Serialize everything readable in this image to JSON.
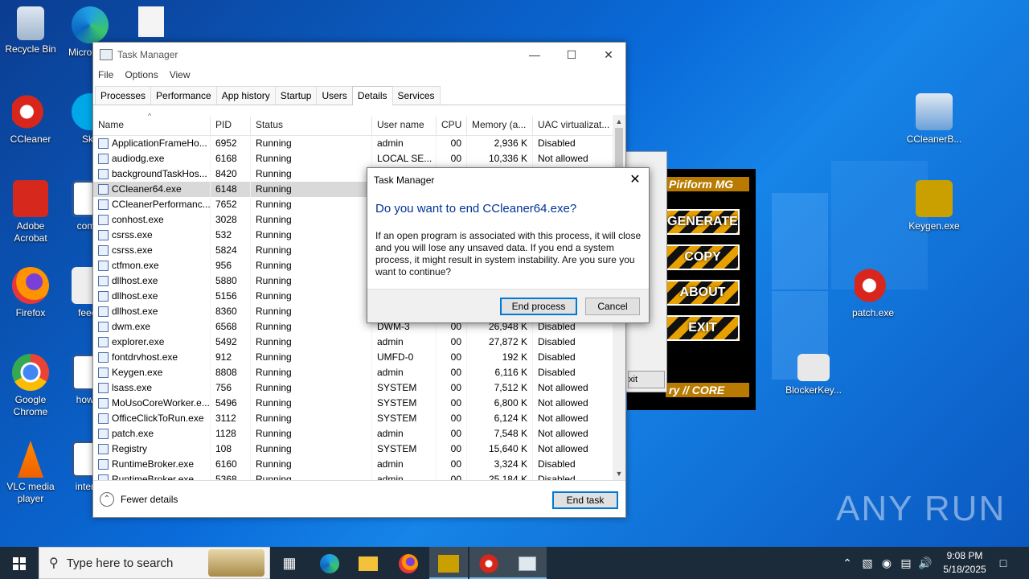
{
  "desktop": {
    "icons_left": [
      {
        "label": "Recycle Bin"
      },
      {
        "label": "CCleaner"
      },
      {
        "label": "Adobe Acrobat"
      },
      {
        "label": "Firefox"
      },
      {
        "label": "Google Chrome"
      },
      {
        "label": "VLC media player"
      }
    ],
    "icons_col2": [
      {
        "label": "Micro Edg"
      },
      {
        "label": "Sky"
      },
      {
        "label": "comm"
      },
      {
        "label": "feeou"
      },
      {
        "label": "howev"
      },
      {
        "label": "interne"
      }
    ],
    "icons_right": [
      {
        "label": "CCleanerB..."
      },
      {
        "label": "Keygen.exe"
      },
      {
        "label": "patch.exe"
      },
      {
        "label": "BlockerKey..."
      }
    ],
    "watermark": "ANY RUN"
  },
  "keygen": {
    "banner_top": "Piriform MG",
    "buttons": [
      "GENERATE",
      "COPY",
      "ABOUT",
      "EXIT"
    ],
    "banner_bottom": "ry // CORE",
    "partial_button": "xit"
  },
  "taskmanager": {
    "title": "Task Manager",
    "menu": [
      "File",
      "Options",
      "View"
    ],
    "tabs": [
      "Processes",
      "Performance",
      "App history",
      "Startup",
      "Users",
      "Details",
      "Services"
    ],
    "active_tab": "Details",
    "columns": [
      "Name",
      "PID",
      "Status",
      "User name",
      "CPU",
      "Memory (a...",
      "UAC virtualizat..."
    ],
    "rows": [
      {
        "name": "ApplicationFrameHo...",
        "pid": "6952",
        "status": "Running",
        "user": "admin",
        "cpu": "00",
        "mem": "2,936 K",
        "uac": "Disabled"
      },
      {
        "name": "audiodg.exe",
        "pid": "6168",
        "status": "Running",
        "user": "LOCAL SE...",
        "cpu": "00",
        "mem": "10,336 K",
        "uac": "Not allowed"
      },
      {
        "name": "backgroundTaskHos...",
        "pid": "8420",
        "status": "Running",
        "user": "",
        "cpu": "",
        "mem": "",
        "uac": ""
      },
      {
        "name": "CCleaner64.exe",
        "pid": "6148",
        "status": "Running",
        "user": "",
        "cpu": "",
        "mem": "",
        "uac": "",
        "selected": true
      },
      {
        "name": "CCleanerPerformanc...",
        "pid": "7652",
        "status": "Running",
        "user": "",
        "cpu": "",
        "mem": "",
        "uac": ""
      },
      {
        "name": "conhost.exe",
        "pid": "3028",
        "status": "Running",
        "user": "",
        "cpu": "",
        "mem": "",
        "uac": ""
      },
      {
        "name": "csrss.exe",
        "pid": "532",
        "status": "Running",
        "user": "",
        "cpu": "",
        "mem": "",
        "uac": ""
      },
      {
        "name": "csrss.exe",
        "pid": "5824",
        "status": "Running",
        "user": "",
        "cpu": "",
        "mem": "",
        "uac": ""
      },
      {
        "name": "ctfmon.exe",
        "pid": "956",
        "status": "Running",
        "user": "",
        "cpu": "",
        "mem": "",
        "uac": ""
      },
      {
        "name": "dllhost.exe",
        "pid": "5880",
        "status": "Running",
        "user": "",
        "cpu": "",
        "mem": "",
        "uac": ""
      },
      {
        "name": "dllhost.exe",
        "pid": "5156",
        "status": "Running",
        "user": "",
        "cpu": "",
        "mem": "",
        "uac": ""
      },
      {
        "name": "dllhost.exe",
        "pid": "8360",
        "status": "Running",
        "user": "",
        "cpu": "",
        "mem": "",
        "uac": ""
      },
      {
        "name": "dwm.exe",
        "pid": "6568",
        "status": "Running",
        "user": "DWM-3",
        "cpu": "00",
        "mem": "26,948 K",
        "uac": "Disabled"
      },
      {
        "name": "explorer.exe",
        "pid": "5492",
        "status": "Running",
        "user": "admin",
        "cpu": "00",
        "mem": "27,872 K",
        "uac": "Disabled"
      },
      {
        "name": "fontdrvhost.exe",
        "pid": "912",
        "status": "Running",
        "user": "UMFD-0",
        "cpu": "00",
        "mem": "192 K",
        "uac": "Disabled"
      },
      {
        "name": "Keygen.exe",
        "pid": "8808",
        "status": "Running",
        "user": "admin",
        "cpu": "00",
        "mem": "6,116 K",
        "uac": "Disabled"
      },
      {
        "name": "lsass.exe",
        "pid": "756",
        "status": "Running",
        "user": "SYSTEM",
        "cpu": "00",
        "mem": "7,512 K",
        "uac": "Not allowed"
      },
      {
        "name": "MoUsoCoreWorker.e...",
        "pid": "5496",
        "status": "Running",
        "user": "SYSTEM",
        "cpu": "00",
        "mem": "6,800 K",
        "uac": "Not allowed"
      },
      {
        "name": "OfficeClickToRun.exe",
        "pid": "3112",
        "status": "Running",
        "user": "SYSTEM",
        "cpu": "00",
        "mem": "6,124 K",
        "uac": "Not allowed"
      },
      {
        "name": "patch.exe",
        "pid": "1128",
        "status": "Running",
        "user": "admin",
        "cpu": "00",
        "mem": "7,548 K",
        "uac": "Not allowed"
      },
      {
        "name": "Registry",
        "pid": "108",
        "status": "Running",
        "user": "SYSTEM",
        "cpu": "00",
        "mem": "15,640 K",
        "uac": "Not allowed"
      },
      {
        "name": "RuntimeBroker.exe",
        "pid": "6160",
        "status": "Running",
        "user": "admin",
        "cpu": "00",
        "mem": "3,324 K",
        "uac": "Disabled"
      },
      {
        "name": "RuntimeBroker.exe",
        "pid": "5368",
        "status": "Running",
        "user": "admin",
        "cpu": "00",
        "mem": "25,184 K",
        "uac": "Disabled"
      }
    ],
    "fewer_details": "Fewer details",
    "end_task": "End task"
  },
  "dialog": {
    "title": "Task Manager",
    "question": "Do you want to end CCleaner64.exe?",
    "message": "If an open program is associated with this process, it will close and you will lose any unsaved data. If you end a system process, it might result in system instability. Are you sure you want to continue?",
    "end_process": "End process",
    "cancel": "Cancel"
  },
  "taskbar": {
    "search_placeholder": "Type here to search",
    "time": "9:08 PM",
    "date": "5/18/2025"
  },
  "colors": {
    "accent": "#0078d7",
    "dialog_heading": "#003399",
    "taskbar": "#1c2b3a"
  }
}
